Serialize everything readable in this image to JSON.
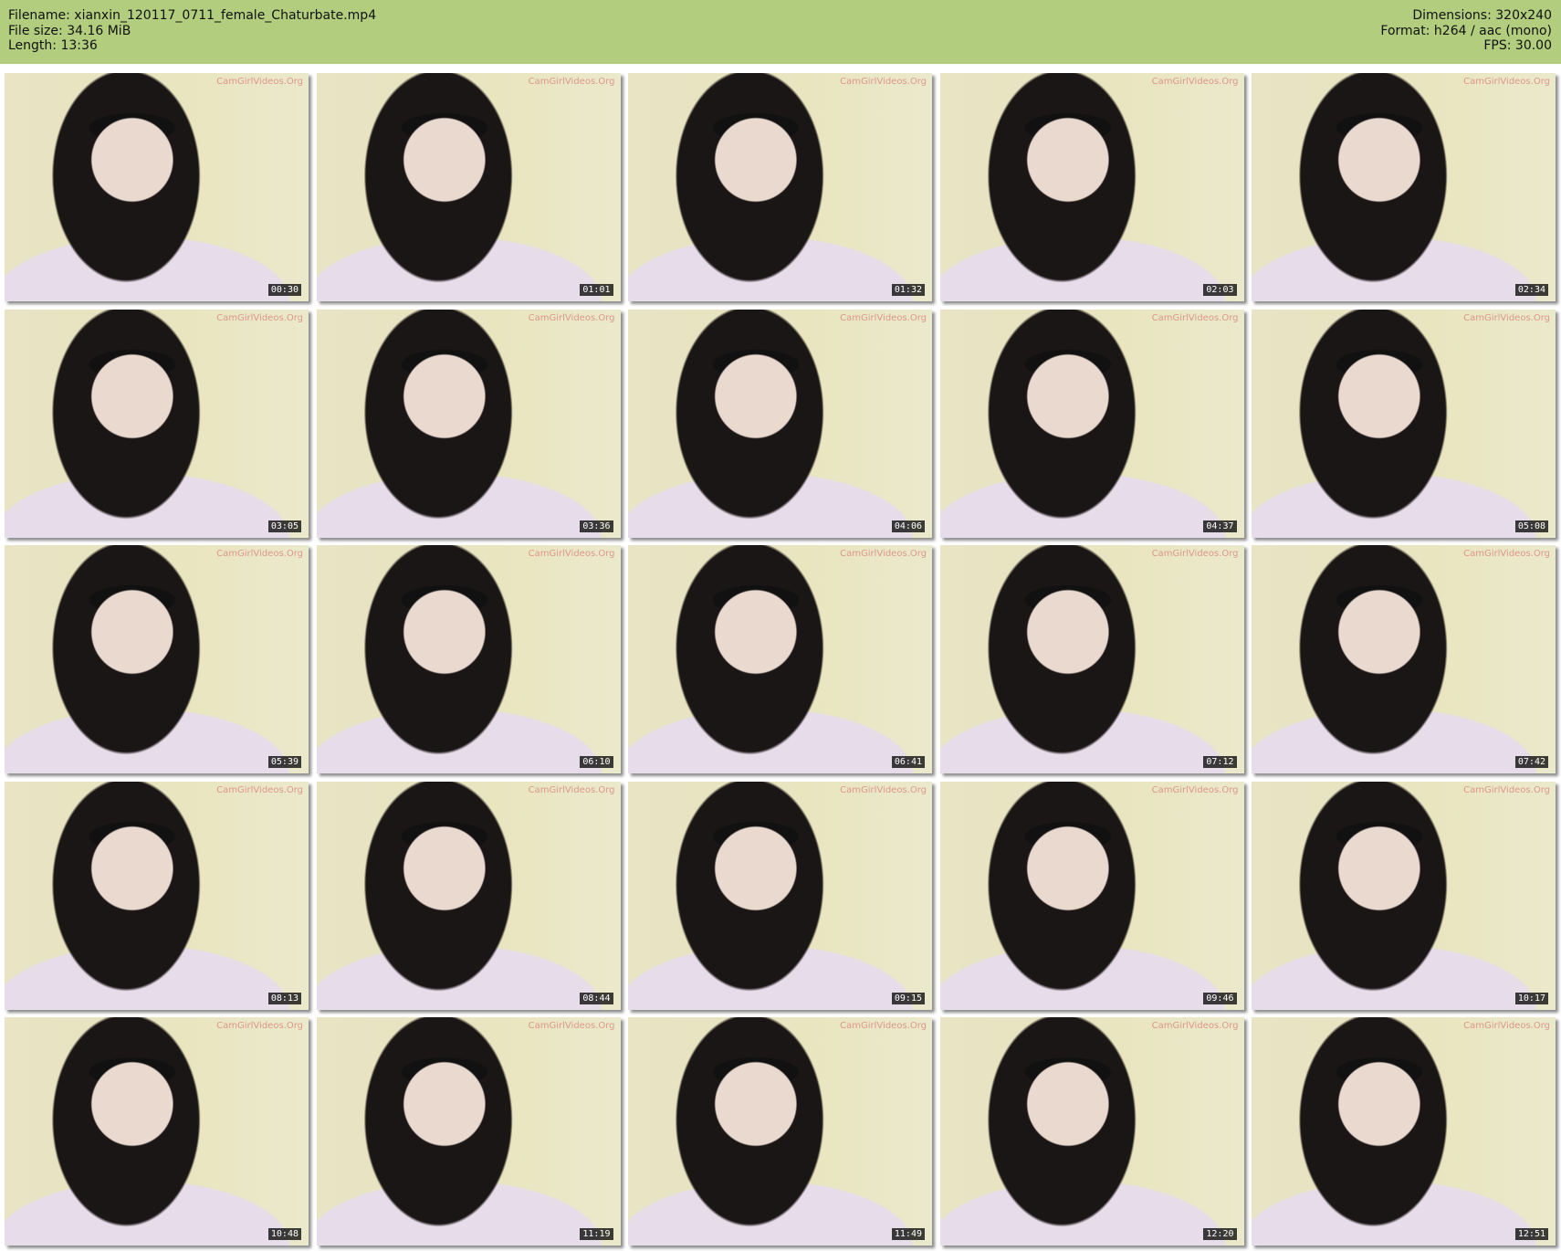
{
  "header": {
    "filename": "Filename: xianxin_120117_0711_female_Chaturbate.mp4",
    "filesize": "File size: 34.16 MiB",
    "length": "Length: 13:36",
    "dimensions": "Dimensions: 320x240",
    "format": "Format: h264 / aac (mono)",
    "fps": "FPS: 30.00"
  },
  "watermark": "CamGirlVideos.Org",
  "thumbnails": [
    "00:30",
    "01:01",
    "01:32",
    "02:03",
    "02:34",
    "03:05",
    "03:36",
    "04:06",
    "04:37",
    "05:08",
    "05:39",
    "06:10",
    "06:41",
    "07:12",
    "07:42",
    "08:13",
    "08:44",
    "09:15",
    "09:46",
    "10:17",
    "10:48",
    "11:19",
    "11:49",
    "12:20",
    "12:51"
  ]
}
